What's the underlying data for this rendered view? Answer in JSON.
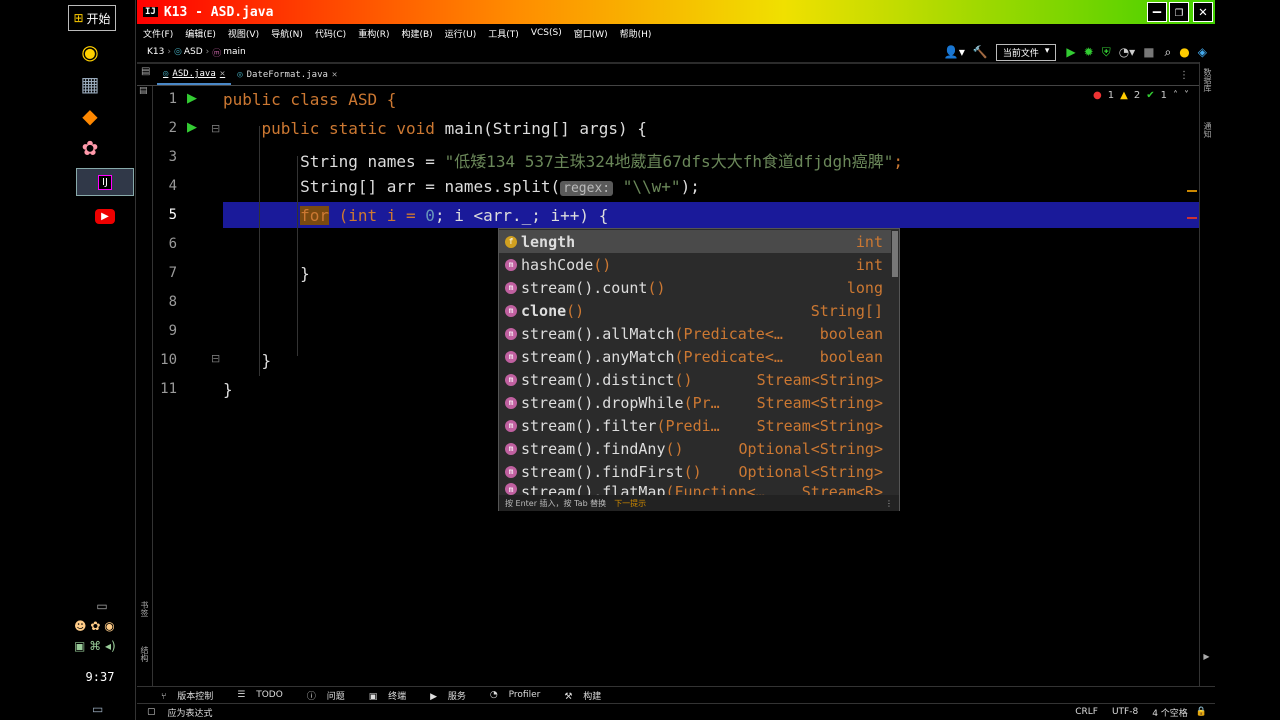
{
  "taskbar": {
    "start_label": "开始",
    "clock": "9:37"
  },
  "window": {
    "title": "K13 - ASD.java",
    "minimize": "—",
    "maximize": "❐",
    "close": "✕"
  },
  "menu": {
    "items": [
      "文件(F)",
      "编辑(E)",
      "视图(V)",
      "导航(N)",
      "代码(C)",
      "重构(R)",
      "构建(B)",
      "运行(U)",
      "工具(T)",
      "VCS(S)",
      "窗口(W)",
      "帮助(H)"
    ]
  },
  "nav": {
    "project": "K13",
    "class": "ASD",
    "method": "main",
    "run_config": "当前文件"
  },
  "tabs": [
    {
      "label": "ASD.java"
    },
    {
      "label": "DateFormat.java"
    }
  ],
  "inspections": {
    "errors": "1",
    "warnings": "2",
    "ok": "1"
  },
  "editor": {
    "line_numbers": [
      "1",
      "2",
      "3",
      "4",
      "5",
      "6",
      "7",
      "8",
      "9",
      "10",
      "11"
    ],
    "line1": "public class ASD {",
    "line2_indent": "    public static void ",
    "line2_main": "main(String[] args) {",
    "line3_pre": "        String names = ",
    "line3_str": "\"低矮134 537主珠324地葳直67dfs大大fh食道dfjdgh癌脾\"",
    "line3_post": ";",
    "line4_pre": "        String[] arr = names.split(",
    "line4_hint": "regex:",
    "line4_str": " \"\\\\w+\"",
    "line4_post": ");",
    "line5_pre": "        ",
    "line5_for": "for",
    "line5_a": " (int i = ",
    "line5_zero": "0",
    "line5_b": "; i <arr._; i++) {",
    "line7": "        }",
    "line10": "    }",
    "line11": "}"
  },
  "completion": {
    "items": [
      {
        "icon": "f",
        "name": "length",
        "args": "",
        "type": "int"
      },
      {
        "icon": "m",
        "name": "hashCode",
        "args": "()",
        "type": "int"
      },
      {
        "icon": "m",
        "name": "stream().count",
        "args": "()",
        "type": "long"
      },
      {
        "icon": "m",
        "name": "clone",
        "args": "()",
        "type": "String[]"
      },
      {
        "icon": "m",
        "name": "stream().allMatch",
        "args": "(Predicate<…",
        "type": "boolean"
      },
      {
        "icon": "m",
        "name": "stream().anyMatch",
        "args": "(Predicate<…",
        "type": "boolean"
      },
      {
        "icon": "m",
        "name": "stream().distinct",
        "args": "()",
        "type": "Stream<String>"
      },
      {
        "icon": "m",
        "name": "stream().dropWhile",
        "args": "(Pr…",
        "type": "Stream<String>"
      },
      {
        "icon": "m",
        "name": "stream().filter",
        "args": "(Predi…",
        "type": "Stream<String>"
      },
      {
        "icon": "m",
        "name": "stream().findAny",
        "args": "()",
        "type": "Optional<String>"
      },
      {
        "icon": "m",
        "name": "stream().findFirst",
        "args": "()",
        "type": "Optional<String>"
      },
      {
        "icon": "m",
        "name": "stream().flatMap",
        "args": "(Function<…",
        "type": "Stream<R>"
      }
    ],
    "footer": "按 Enter 插入，按 Tab 替换",
    "footer_link": "下一提示"
  },
  "toolwindows": [
    "版本控制",
    "TODO",
    "问题",
    "终端",
    "服务",
    "Profiler",
    "构建"
  ],
  "status": {
    "message": "应为表达式",
    "line_sep": "CRLF",
    "encoding": "UTF-8",
    "indent": "4 个空格"
  }
}
